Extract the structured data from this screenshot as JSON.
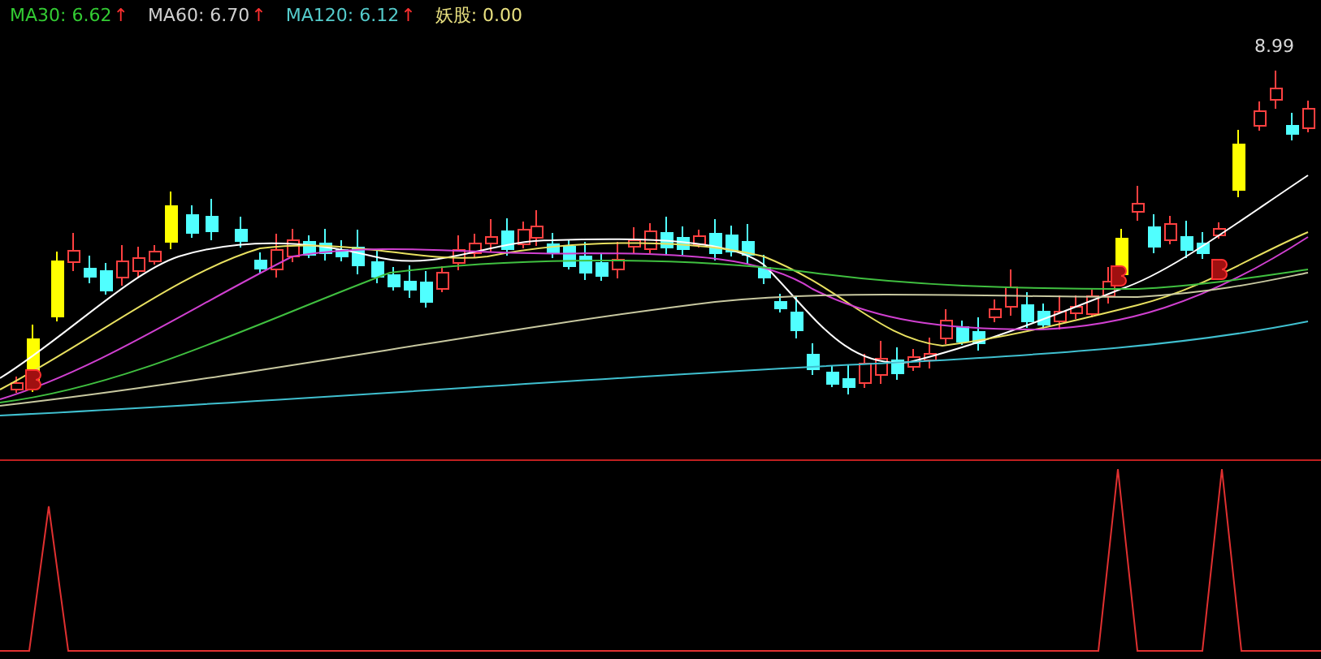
{
  "legend": [
    {
      "label": "MA30: 6.62",
      "arrow": "↑",
      "color": "#33cc33"
    },
    {
      "label": "MA60: 6.70",
      "arrow": "↑",
      "color": "#d0d0d0"
    },
    {
      "label": "MA120: 6.12",
      "arrow": "↑",
      "color": "#55cccc"
    },
    {
      "label": "妖股: 0.00",
      "color": "#e8e080"
    }
  ],
  "price_chart": {
    "high_label": "8.99"
  }
}
